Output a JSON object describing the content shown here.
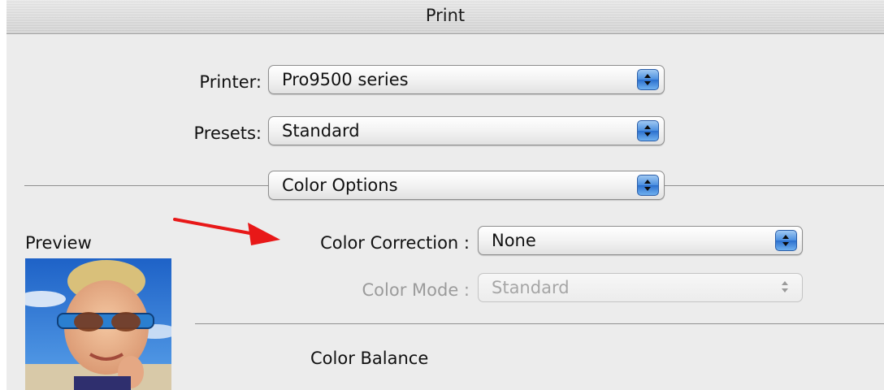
{
  "window": {
    "title": "Print"
  },
  "form": {
    "printer_label": "Printer:",
    "printer_value": "Pro9500 series",
    "presets_label": "Presets:",
    "presets_value": "Standard",
    "section_value": "Color Options"
  },
  "color_options": {
    "preview_label": "Preview",
    "color_correction_label": "Color Correction :",
    "color_correction_value": "None",
    "color_mode_label": "Color Mode :",
    "color_mode_value": "Standard",
    "color_balance_label": "Color Balance"
  },
  "icons": {
    "popup_arrows": "up-down-arrows-icon",
    "annotation": "red-arrow-icon",
    "preview": "preview-image"
  },
  "colors": {
    "accent_blue": "#4a8fe0",
    "annotation_red": "#e81818",
    "window_bg": "#ececec"
  }
}
